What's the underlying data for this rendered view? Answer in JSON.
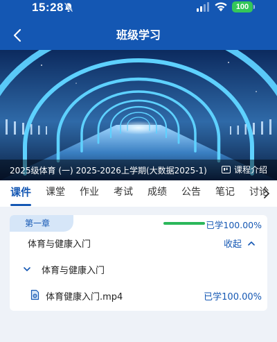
{
  "status_bar": {
    "time": "15:28",
    "battery": "100",
    "bell_icon": "bell-slash-icon",
    "wifi_icon": "wifi-icon"
  },
  "header": {
    "title": "班级学习",
    "back_icon": "chevron-left-icon"
  },
  "banner": {
    "course_name": "2025级体育 (一) 2025-2026上学期(大数据2025-1)",
    "intro_label": "课程介绍",
    "intro_icon": "book-info-icon"
  },
  "tabs": {
    "items": [
      {
        "label": "课件"
      },
      {
        "label": "课堂"
      },
      {
        "label": "作业"
      },
      {
        "label": "考试"
      },
      {
        "label": "成绩"
      },
      {
        "label": "公告"
      },
      {
        "label": "笔记"
      },
      {
        "label": "讨论"
      }
    ],
    "active_index": 0,
    "more_icon": "chevron-right-icon"
  },
  "chapter": {
    "tag": "第一章",
    "progress_text": "已学100.00%",
    "progress_fraction": 1.0,
    "section_title": "体育与健康入门",
    "collapse_label": "收起",
    "subsection": {
      "title": "体育与健康入门",
      "file": {
        "name": "体育健康入门.mp4",
        "progress_text": "已学100.00%",
        "icon": "video-file-icon"
      }
    }
  },
  "colors": {
    "primary": "#1457b3",
    "progress": "#2bb75a",
    "tag_bg": "#d6e6f8",
    "battery": "#34c759"
  }
}
